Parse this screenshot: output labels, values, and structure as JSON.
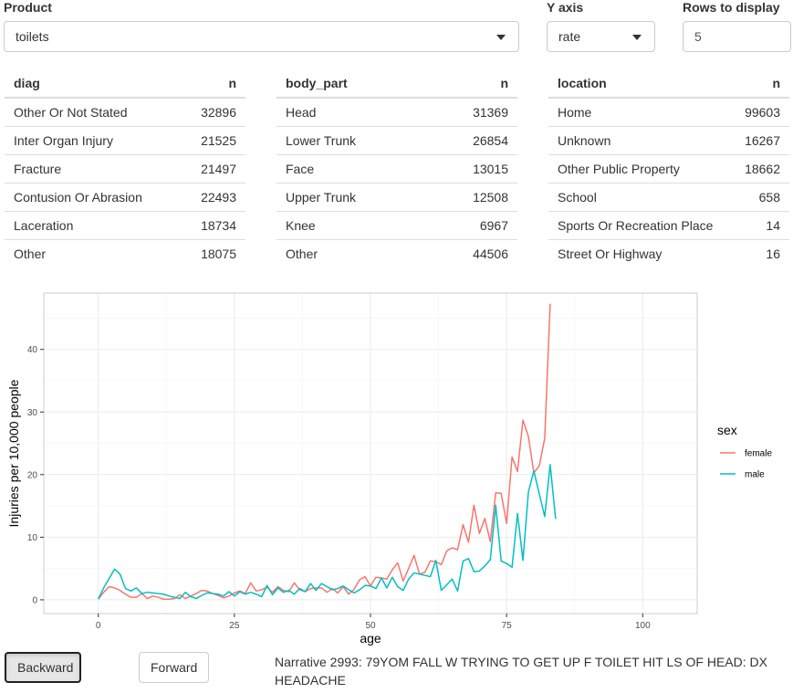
{
  "controls": {
    "product_label": "Product",
    "product_value": "toilets",
    "yaxis_label": "Y axis",
    "yaxis_value": "rate",
    "rows_label": "Rows to display",
    "rows_value": "5"
  },
  "tables": {
    "diag": {
      "headers": [
        "diag",
        "n"
      ],
      "rows": [
        {
          "label": "Other Or Not Stated",
          "n": "32896"
        },
        {
          "label": "Inter Organ Injury",
          "n": "21525"
        },
        {
          "label": "Fracture",
          "n": "21497"
        },
        {
          "label": "Contusion Or Abrasion",
          "n": "22493"
        },
        {
          "label": "Laceration",
          "n": "18734"
        },
        {
          "label": "Other",
          "n": "18075"
        }
      ]
    },
    "body_part": {
      "headers": [
        "body_part",
        "n"
      ],
      "rows": [
        {
          "label": "Head",
          "n": "31369"
        },
        {
          "label": "Lower Trunk",
          "n": "26854"
        },
        {
          "label": "Face",
          "n": "13015"
        },
        {
          "label": "Upper Trunk",
          "n": "12508"
        },
        {
          "label": "Knee",
          "n": "6967"
        },
        {
          "label": "Other",
          "n": "44506"
        }
      ]
    },
    "location": {
      "headers": [
        "location",
        "n"
      ],
      "rows": [
        {
          "label": "Home",
          "n": "99603"
        },
        {
          "label": "Unknown",
          "n": "16267"
        },
        {
          "label": "Other Public Property",
          "n": "18662"
        },
        {
          "label": "School",
          "n": "658"
        },
        {
          "label": "Sports Or Recreation Place",
          "n": "14"
        },
        {
          "label": "Street Or Highway",
          "n": "16"
        }
      ]
    }
  },
  "chart_data": {
    "type": "line",
    "title": "",
    "xlabel": "age",
    "ylabel": "Injuries per 10,000 people",
    "xlim": [
      -10,
      110
    ],
    "ylim": [
      -2.2,
      49
    ],
    "xticks": [
      0,
      25,
      50,
      75,
      100
    ],
    "yticks": [
      0,
      10,
      20,
      30,
      40
    ],
    "grid": true,
    "legend_title": "sex",
    "legend_position": "right",
    "x": [
      0,
      1,
      2,
      3,
      4,
      5,
      6,
      7,
      8,
      9,
      10,
      11,
      12,
      13,
      14,
      15,
      16,
      17,
      18,
      19,
      20,
      21,
      22,
      23,
      24,
      25,
      26,
      27,
      28,
      29,
      30,
      31,
      32,
      33,
      34,
      35,
      36,
      37,
      38,
      39,
      40,
      41,
      42,
      43,
      44,
      45,
      46,
      47,
      48,
      49,
      50,
      51,
      52,
      53,
      54,
      55,
      56,
      57,
      58,
      59,
      60,
      61,
      62,
      63,
      64,
      65,
      66,
      67,
      68,
      69,
      70,
      71,
      72,
      73,
      74,
      75,
      76,
      77,
      78,
      79,
      80,
      81,
      82,
      83,
      84
    ],
    "series": [
      {
        "name": "female",
        "color": "#F8766D",
        "values": [
          0.1,
          1.2,
          2.1,
          1.9,
          1.5,
          0.9,
          0.4,
          0.4,
          1.0,
          0.2,
          0.6,
          0.4,
          0.1,
          0.1,
          0.2,
          0.8,
          0.2,
          0.6,
          1.0,
          1.5,
          1.4,
          1.0,
          0.7,
          0.3,
          0.6,
          1.1,
          1.4,
          1.0,
          2.7,
          1.4,
          1.6,
          2.0,
          1.2,
          2.1,
          1.5,
          1.3,
          2.7,
          1.6,
          1.3,
          1.8,
          1.9,
          1.9,
          1.2,
          1.8,
          1.1,
          2.1,
          0.9,
          1.7,
          3.2,
          3.7,
          2.2,
          3.6,
          3.5,
          3.3,
          4.8,
          5.9,
          3.0,
          5.0,
          7.1,
          4.1,
          4.4,
          6.2,
          6.1,
          5.6,
          7.8,
          8.3,
          8.0,
          12.0,
          9.2,
          15.1,
          10.6,
          13.0,
          9.3,
          17.1,
          17.0,
          12.2,
          22.8,
          20.5,
          28.7,
          26.1,
          20.3,
          21.4,
          25.8,
          47.3,
          null
        ]
      },
      {
        "name": "male",
        "color": "#00BFC4",
        "values": [
          0.1,
          1.9,
          3.4,
          4.9,
          4.1,
          1.8,
          1.4,
          1.9,
          1.0,
          1.2,
          1.1,
          1.0,
          0.9,
          0.6,
          0.4,
          0.2,
          1.2,
          0.5,
          0.2,
          0.7,
          1.1,
          1.0,
          0.9,
          0.6,
          1.3,
          0.6,
          1.3,
          0.9,
          1.2,
          0.9,
          0.5,
          2.3,
          0.8,
          1.9,
          1.2,
          1.5,
          0.9,
          1.8,
          1.3,
          2.6,
          1.5,
          2.6,
          2.1,
          1.6,
          1.8,
          2.2,
          1.6,
          1.1,
          1.6,
          2.3,
          2.2,
          1.8,
          3.5,
          1.9,
          3.6,
          2.1,
          1.5,
          3.3,
          4.3,
          4.1,
          3.9,
          3.7,
          6.3,
          1.5,
          2.4,
          3.3,
          1.4,
          6.2,
          6.6,
          4.5,
          4.6,
          5.4,
          6.4,
          15.1,
          6.2,
          5.8,
          5.2,
          13.8,
          6.3,
          17.2,
          20.6,
          16.9,
          13.3,
          21.6,
          12.9
        ]
      }
    ]
  },
  "buttons": {
    "backward_label": "Backward",
    "forward_label": "Forward"
  },
  "narrative": "Narrative 2993: 79YOM FALL W TRYING TO GET UP F TOILET HIT LS OF HEAD: DX HEADACHE"
}
